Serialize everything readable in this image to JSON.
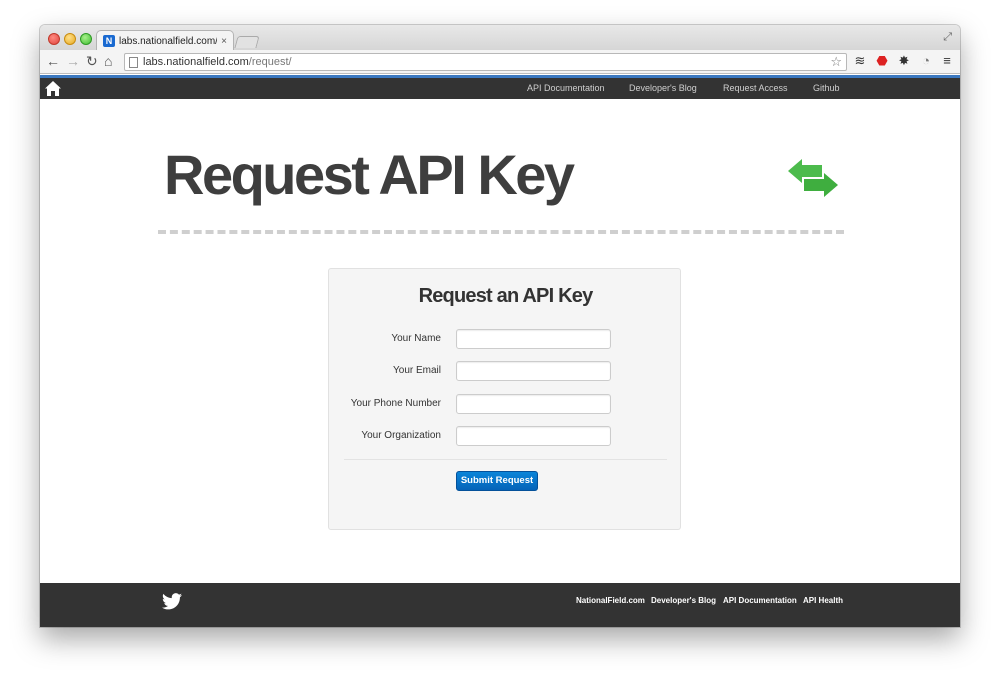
{
  "browser": {
    "tab_title": "labs.nationalfield.com/req",
    "tab_close": "×",
    "favicon_letter": "N",
    "url_host": "labs.nationalfield.com",
    "url_path": "/request/"
  },
  "site_nav": {
    "links": [
      "API Documentation",
      "Developer's Blog",
      "Request Access",
      "Github"
    ]
  },
  "page": {
    "title": "Request API Key"
  },
  "form": {
    "heading": "Request an API Key",
    "fields": [
      {
        "label": "Your Name",
        "value": ""
      },
      {
        "label": "Your Email",
        "value": ""
      },
      {
        "label": "Your Phone Number",
        "value": ""
      },
      {
        "label": "Your Organization",
        "value": ""
      }
    ],
    "submit_label": "Submit Request"
  },
  "footer": {
    "links": [
      "NationalField.com",
      "Developer's Blog",
      "API Documentation",
      "API Health"
    ]
  },
  "colors": {
    "navbar_bg": "#333333",
    "nav_accent": "#3b78c0",
    "primary_button": "#0a6fc9",
    "arrows_green": "#4cbb4c",
    "title_text": "#3e3e3e"
  },
  "icons": [
    "home-icon",
    "arrows-exchange-icon",
    "twitter-icon",
    "star-icon",
    "back-arrow-icon",
    "forward-arrow-icon",
    "reload-icon"
  ]
}
